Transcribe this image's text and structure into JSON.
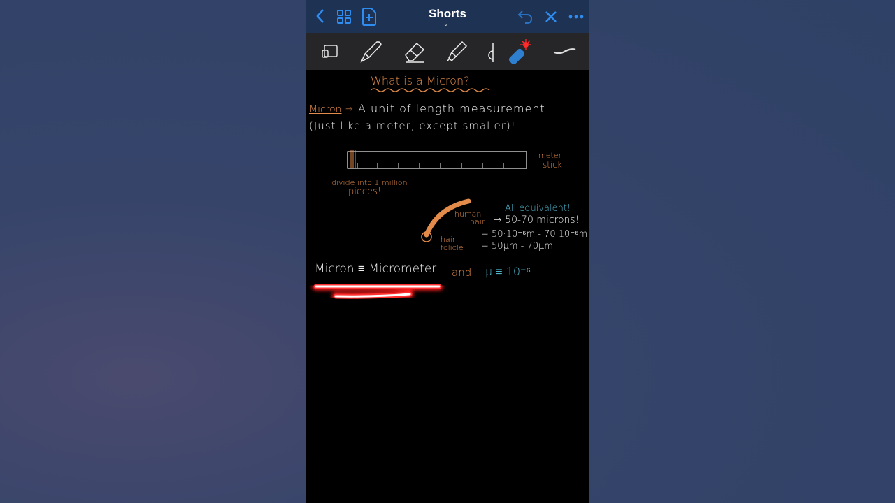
{
  "header": {
    "title": "Shorts",
    "icons": [
      "chevron-left-icon",
      "grid-icon",
      "add-page-icon",
      "undo-icon",
      "close-icon",
      "more-icon"
    ],
    "accent": "#2f8cf0"
  },
  "toolbar": {
    "tools": [
      "lasso-icon",
      "pen-icon",
      "eraser-icon",
      "highlighter-icon",
      "shape-icon",
      "laser-pointer-icon",
      "stroke-width-icon"
    ]
  },
  "notes": {
    "title": "What is a Micron?",
    "line1_label": "Micron",
    "line1_arrow": "→",
    "line1_text": "A unit of length measurement",
    "line2": "(Just like a meter, except smaller)!",
    "meter_label1": "meter",
    "meter_label2": "stick",
    "divide1": "divide into 1 million",
    "divide2": "pieces!",
    "human1": "human",
    "human2": "hair",
    "follicle1": "hair",
    "follicle2": "folicle",
    "equiv": "All equivalent!",
    "eq1": "→ 50-70 microns!",
    "eq2": "= 50·10⁻⁶m - 70·10⁻⁶m",
    "eq3": "= 50μm - 70μm",
    "def_white": "Micron ≡ Micrometer",
    "def_and": "and",
    "def_cyan": "μ ≡ 10⁻⁶"
  },
  "colors": {
    "orange": "#e38b4a",
    "cyan": "#4fb4cc",
    "laser": "#ff1a1a"
  }
}
